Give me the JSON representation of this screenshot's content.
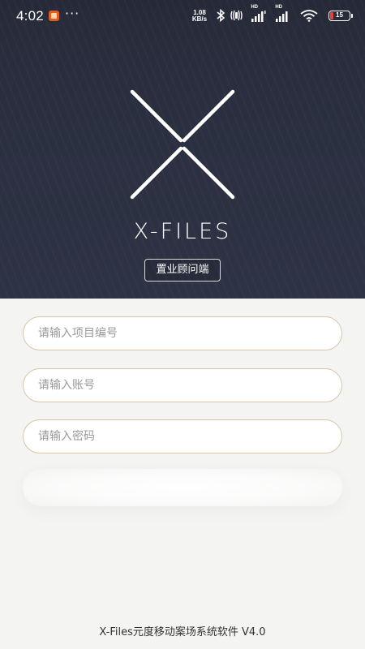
{
  "status_bar": {
    "time": "4:02",
    "more": "···",
    "net_speed_value": "1.08",
    "net_speed_unit": "KB/s",
    "hd_label": "HD",
    "battery_level": "15",
    "battery_color": "#e8413b",
    "icons": [
      "notification-app-icon",
      "bluetooth-icon",
      "vibrate-icon",
      "signal-icon",
      "signal-icon",
      "wifi-icon",
      "battery-icon"
    ]
  },
  "hero": {
    "brand": "X-FILES",
    "role_button": "置业顾问端"
  },
  "form": {
    "project_placeholder": "请输入项目编号",
    "account_placeholder": "请输入账号",
    "password_placeholder": "请输入密码",
    "field_border_color": "#d6c6a7"
  },
  "footer": {
    "text": "X-Files元度移动案场系统软件 V4.0"
  },
  "colors": {
    "hero_bg": "#2b3041",
    "page_bg": "#f4f4f3"
  }
}
